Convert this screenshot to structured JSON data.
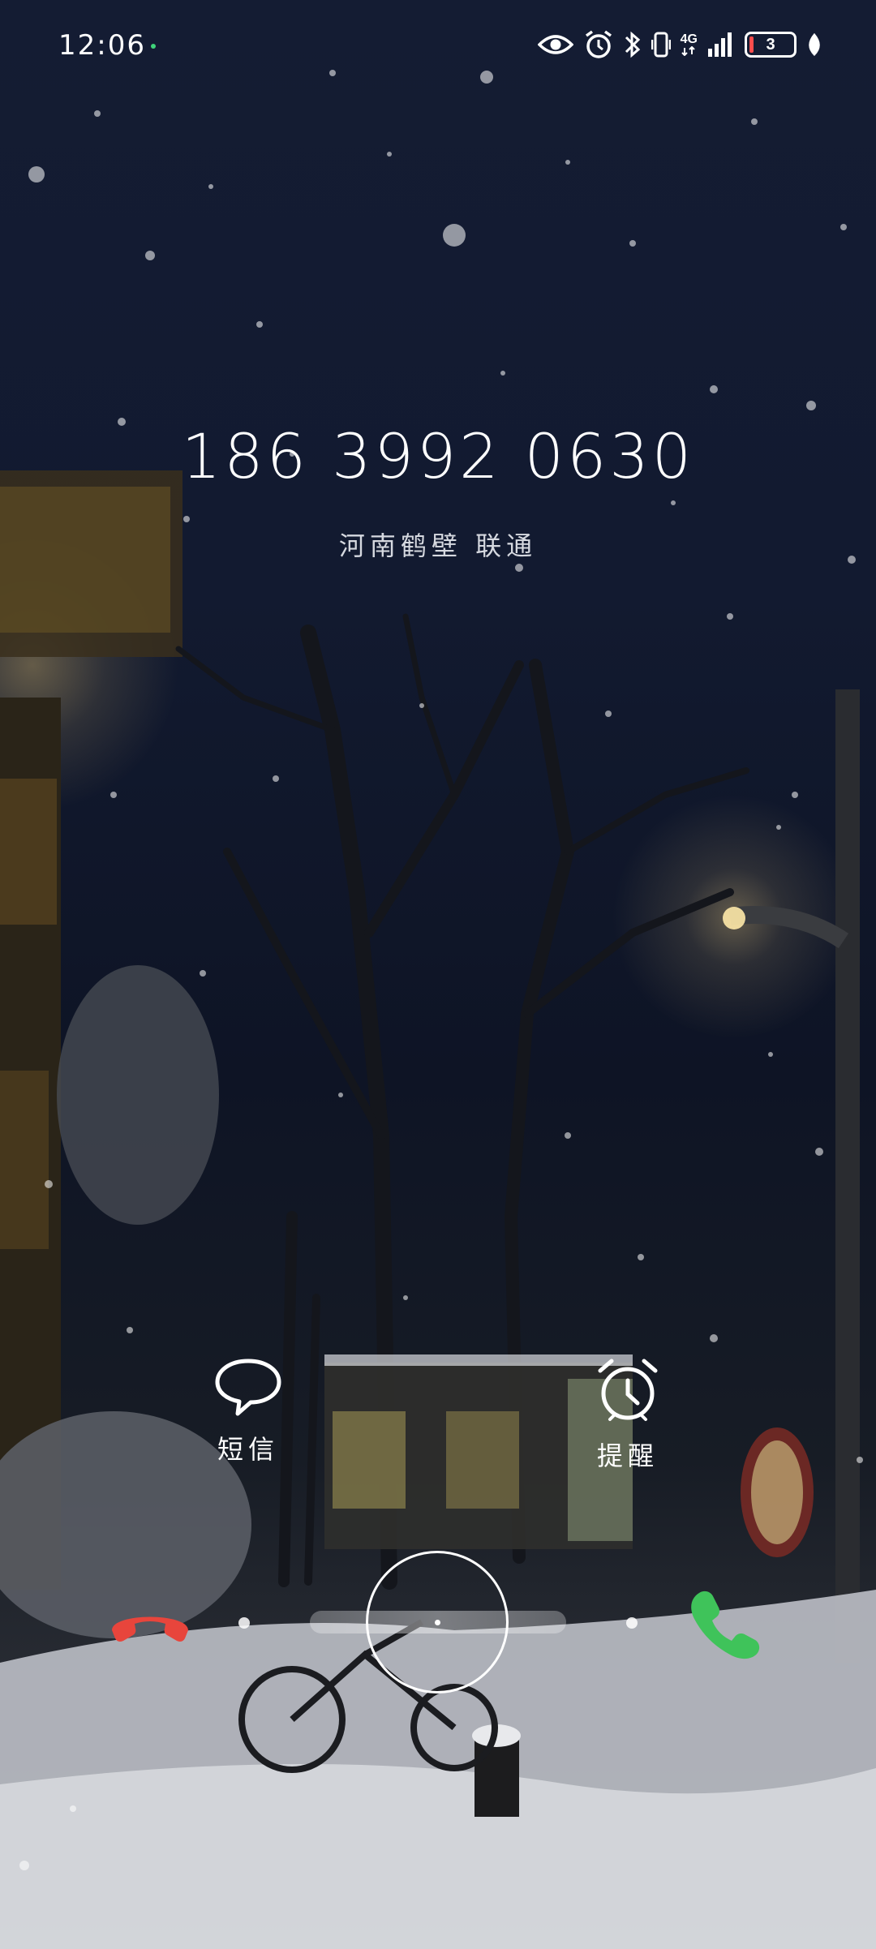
{
  "status_bar": {
    "time": "12:06",
    "network_label": "4G",
    "battery_level": "3",
    "icons": [
      "eye-comfort-icon",
      "alarm-icon",
      "bluetooth-icon",
      "vibrate-icon",
      "signal-icon",
      "battery-icon",
      "leaf-icon"
    ]
  },
  "caller": {
    "number": "186 3992 0630",
    "location": "河南鹤壁 联通"
  },
  "quick_actions": [
    {
      "label": "短信",
      "icon": "message-bubble-icon"
    },
    {
      "label": "提醒",
      "icon": "alarm-clock-icon"
    }
  ],
  "slider": {
    "decline_icon": "phone-hangup-icon",
    "answer_icon": "phone-answer-icon",
    "colors": {
      "decline": "#e8453c",
      "answer": "#3fc35a"
    }
  },
  "wallpaper": "snowy-night-street"
}
